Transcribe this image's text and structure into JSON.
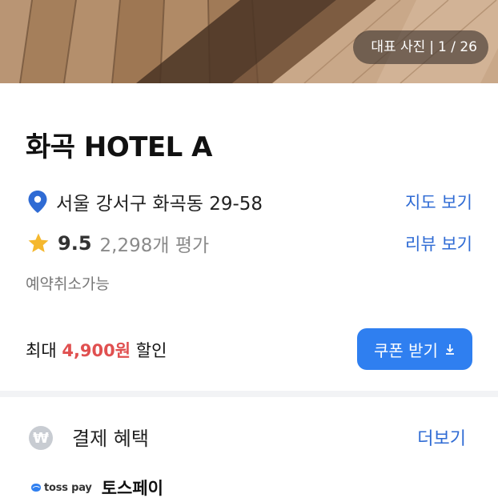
{
  "gallery": {
    "label": "대표 사진",
    "separator": "|",
    "position": "1 / 26"
  },
  "hotel": {
    "name": "화곡 HOTEL A",
    "address": "서울 강서구 화곡동 29-58",
    "map_link": "지도 보기",
    "rating": "9.5",
    "review_count": "2,298개 평가",
    "review_link": "리뷰 보기",
    "cancel_note": "예약취소가능"
  },
  "discount": {
    "prefix": "최대",
    "amount": "4,900원",
    "suffix": "할인",
    "coupon_button": "쿠폰 받기"
  },
  "benefits": {
    "icon": "won-icon",
    "icon_glyph": "₩",
    "title": "결제 혜택",
    "more_link": "더보기",
    "pay_logo_text": "toss pay",
    "pay_name": "토스페이"
  },
  "colors": {
    "accent": "#2f7ff0",
    "link": "#2f6bd4",
    "discount_red": "#e05050",
    "star": "#f5b82e",
    "pin": "#2f6bd4"
  }
}
